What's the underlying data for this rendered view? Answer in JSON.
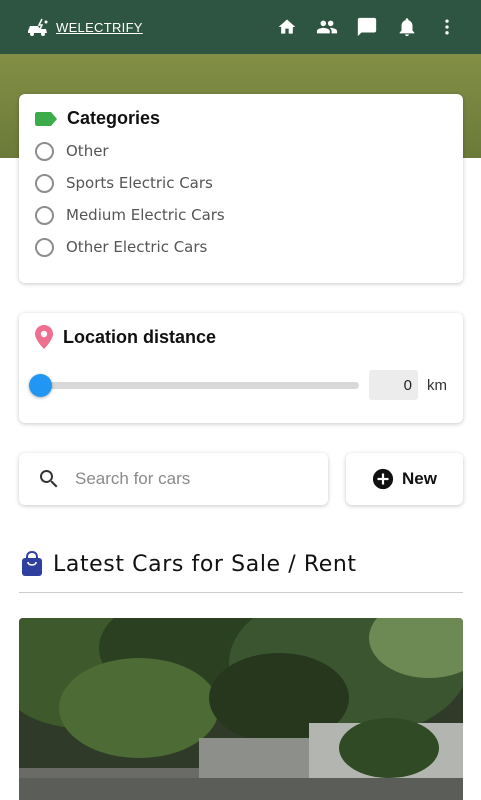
{
  "app": {
    "brand": "WELECTRIFY"
  },
  "categories": {
    "title": "Categories",
    "options": [
      "Other",
      "Sports Electric Cars",
      "Medium Electric Cars",
      "Other Electric Cars"
    ]
  },
  "location": {
    "title": "Location distance",
    "slider_fraction": 0,
    "value": "0",
    "unit": "km"
  },
  "search": {
    "placeholder": "Search for cars"
  },
  "new_button": {
    "label": "New"
  },
  "section": {
    "title": "Latest Cars for Sale / Rent"
  },
  "colors": {
    "topbar": "#2e5541",
    "hero": "#838f45",
    "accent": "#2196f3",
    "tag": "#3cab4a",
    "pin": "#ef6f8f",
    "bag": "#2f3fa0"
  }
}
